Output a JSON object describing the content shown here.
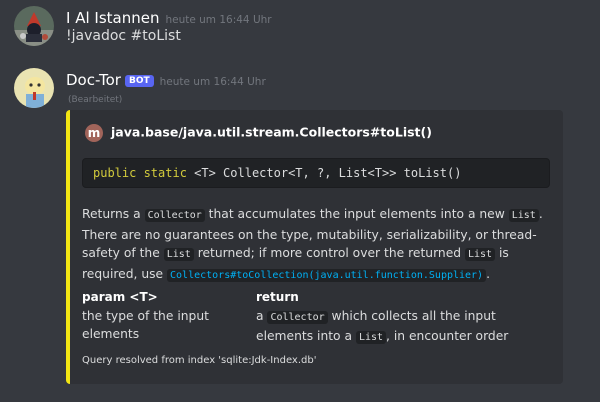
{
  "messages": [
    {
      "username": "I Al Istannen",
      "timestamp": "heute um 16:44 Uhr",
      "text": "!javadoc #toList"
    },
    {
      "username": "Doc-Tor",
      "badge": "BOT",
      "timestamp": "heute um 16:44 Uhr",
      "edited": "(Bearbeitet)",
      "embed": {
        "accent_color": "#f3e613",
        "author_icon": "m",
        "author": "java.base/java.util.stream.Collectors#toList()",
        "signature_keywords": "public static",
        "signature_rest": " <T> Collector<T, ?, List<T>> toList()",
        "desc": {
          "p1": "Returns a ",
          "c1": "Collector",
          "p2": " that accumulates the input elements into a new ",
          "c2": "List",
          "p3": ". There are no guarantees on the type, mutability, serializability, or thread-safety of the ",
          "c3": "List",
          "p4": " returned; if more control over the returned ",
          "c4": "List",
          "p5": " is required, use ",
          "link": "Collectors#toCollection(java.util.function.Supplier)",
          "p6": "."
        },
        "fields": [
          {
            "name": "param <T>",
            "value": "the type of the input elements"
          },
          {
            "name": "return",
            "v1": "a ",
            "c1": "Collector",
            "v2": " which collects all the input elements into a ",
            "c2": "List",
            "v3": ", in encounter order"
          }
        ],
        "footer": "Query resolved from index 'sqlite:Jdk-Index.db'"
      }
    }
  ]
}
